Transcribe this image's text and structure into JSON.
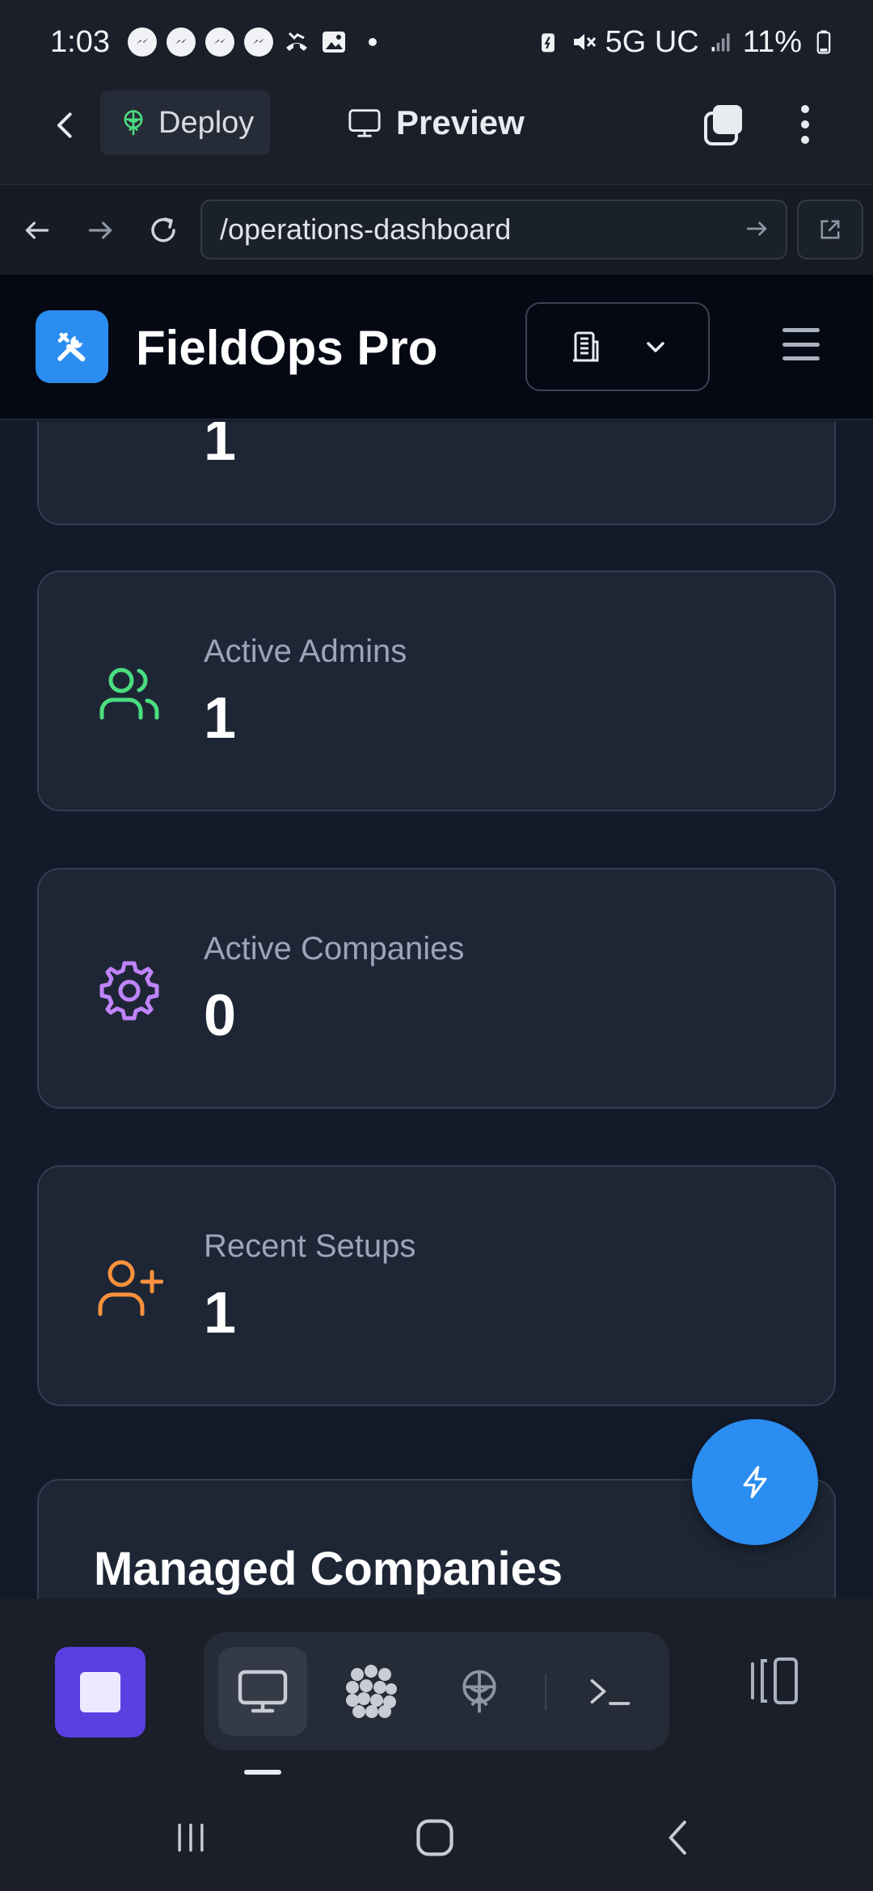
{
  "status_bar": {
    "time": "1:03",
    "network": "5G UC",
    "battery": "11%",
    "notification_icons": [
      "messenger-icon",
      "messenger-icon",
      "messenger-icon",
      "messenger-icon",
      "missed-call-icon",
      "image-icon"
    ]
  },
  "preview_bar": {
    "deploy_label": "Deploy",
    "preview_label": "Preview"
  },
  "url_bar": {
    "url": "/operations-dashboard"
  },
  "site_header": {
    "brand": "FieldOps Pro"
  },
  "stats": [
    {
      "label": "",
      "value": "1",
      "icon": "card-icon",
      "color": "#60a5fa"
    },
    {
      "label": "Active Admins",
      "value": "1",
      "icon": "users-icon",
      "color": "#4ade80"
    },
    {
      "label": "Active Companies",
      "value": "0",
      "icon": "gear-icon",
      "color": "#c084fc"
    },
    {
      "label": "Recent Setups",
      "value": "1",
      "icon": "user-plus-icon",
      "color": "#fb923c"
    }
  ],
  "section": {
    "title": "Managed Companies"
  },
  "colors": {
    "accent": "#2b8df0",
    "stop_button": "#5b3fe0",
    "card_bg": "#1e2636",
    "page_bg": "#131a2a"
  }
}
